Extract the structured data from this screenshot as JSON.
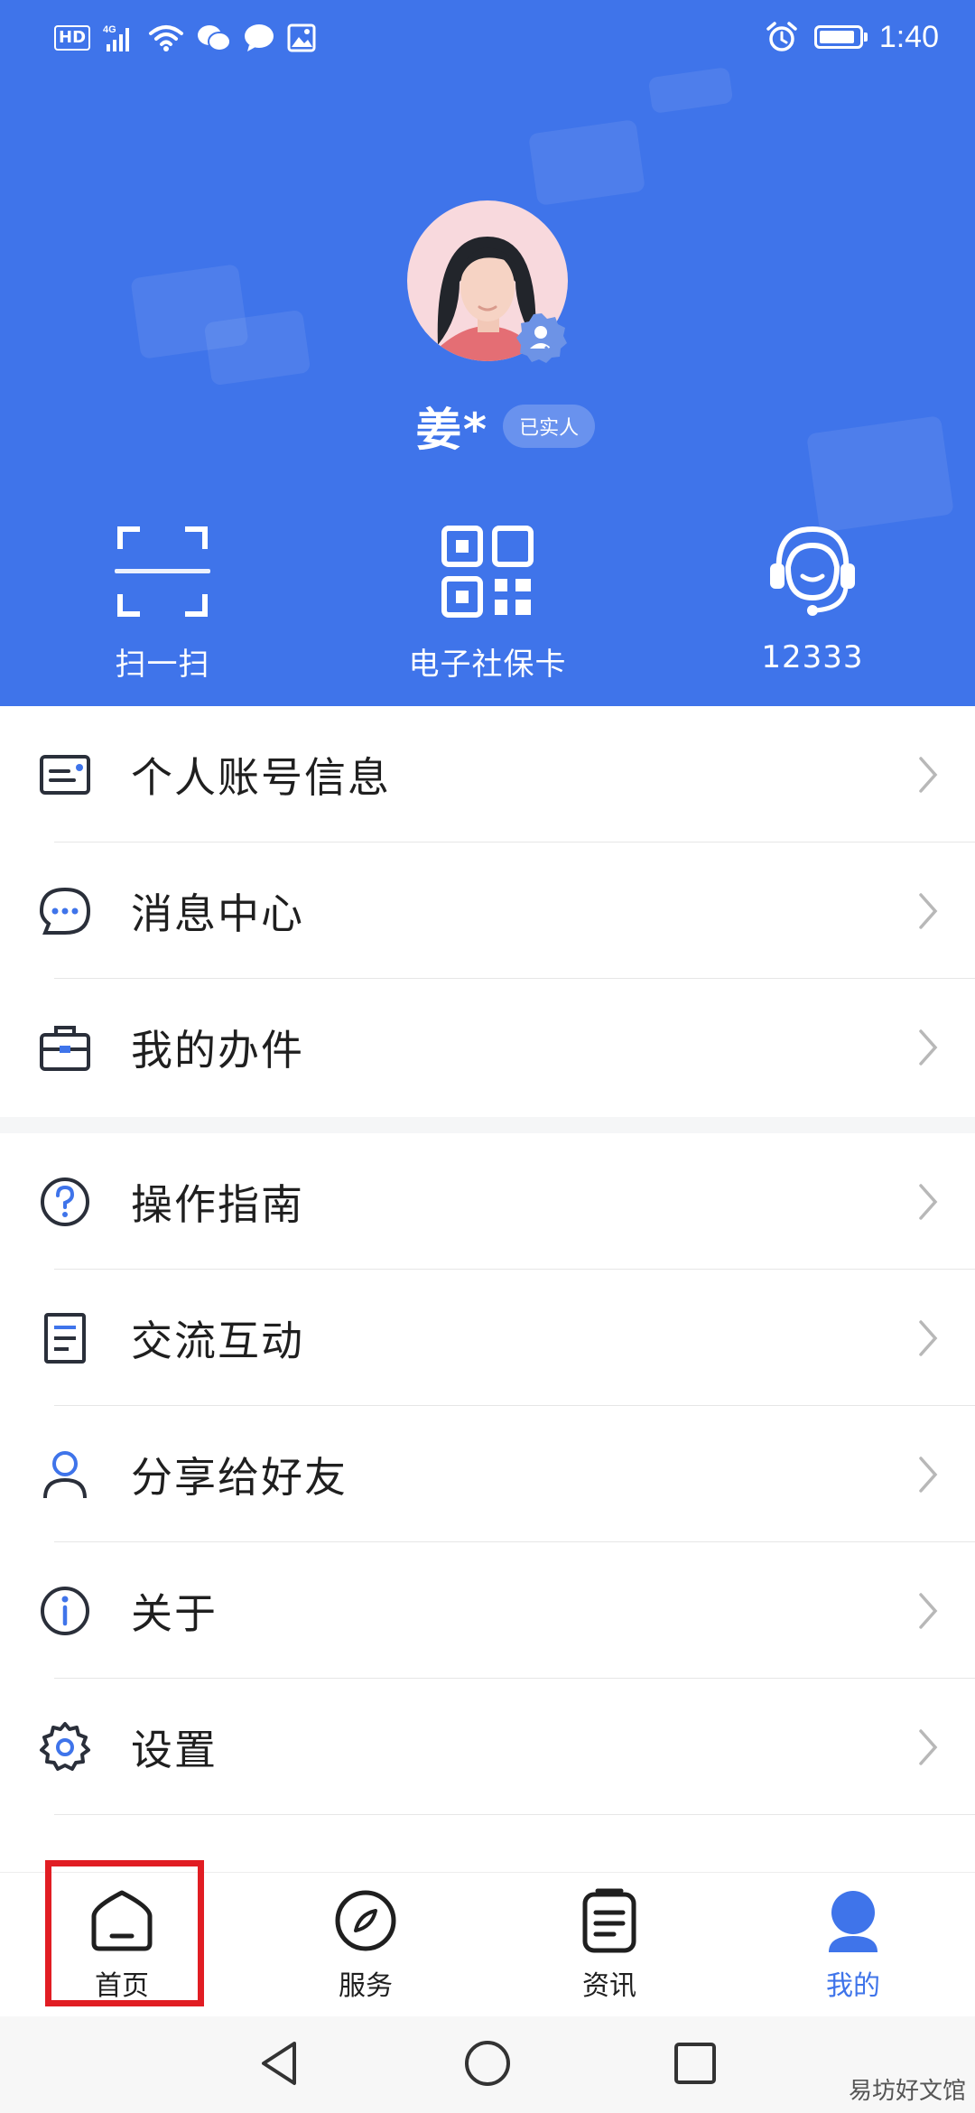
{
  "status_bar": {
    "network_badge": "HD",
    "time": "1:40",
    "icons": [
      "hd-icon",
      "signal-4g-icon",
      "wifi-icon",
      "wechat-icon",
      "message-icon",
      "image-icon",
      "alarm-icon",
      "battery-icon"
    ]
  },
  "profile": {
    "name": "姜*",
    "verify_tag": "已实人"
  },
  "quick_actions": [
    {
      "label": "扫一扫",
      "icon": "scan-icon"
    },
    {
      "label": "电子社保卡",
      "icon": "qr-code-icon"
    },
    {
      "label": "12333",
      "icon": "customer-service-icon"
    }
  ],
  "menu_group_1": [
    {
      "label": "个人账号信息",
      "icon": "id-card-icon"
    },
    {
      "label": "消息中心",
      "icon": "chat-bubble-icon"
    },
    {
      "label": "我的办件",
      "icon": "briefcase-icon"
    }
  ],
  "menu_group_2": [
    {
      "label": "操作指南",
      "icon": "question-icon"
    },
    {
      "label": "交流互动",
      "icon": "document-icon"
    },
    {
      "label": "分享给好友",
      "icon": "user-icon"
    },
    {
      "label": "关于",
      "icon": "info-icon"
    },
    {
      "label": "设置",
      "icon": "gear-icon"
    }
  ],
  "tabs": [
    {
      "label": "首页",
      "icon": "home-icon",
      "active": false
    },
    {
      "label": "服务",
      "icon": "compass-icon",
      "active": false
    },
    {
      "label": "资讯",
      "icon": "news-icon",
      "active": false
    },
    {
      "label": "我的",
      "icon": "profile-icon",
      "active": true
    }
  ],
  "colors": {
    "header_bg": "#3f74ea",
    "active_tab": "#3f74ea",
    "highlight": "#e11d23"
  },
  "watermark": "易坊好文馆"
}
